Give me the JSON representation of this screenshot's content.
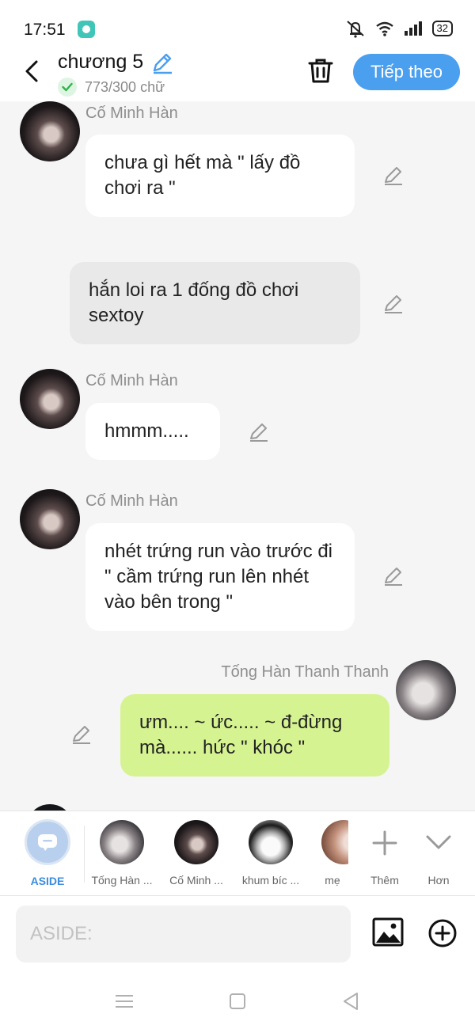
{
  "status_bar": {
    "time": "17:51",
    "battery": "32"
  },
  "header": {
    "title": "chương 5",
    "word_count": "773/300 chữ",
    "next_label": "Tiếp theo"
  },
  "messages": [
    {
      "side": "left",
      "sender": "Cố Minh Hàn",
      "text": "chưa gì hết mà \" lấy đồ chơi ra \"",
      "style": "white"
    },
    {
      "side": "narration",
      "text": "hắn loi ra 1 đống đồ chơi sextoy",
      "style": "gray"
    },
    {
      "side": "left",
      "sender": "Cố Minh Hàn",
      "text": "hmmm.....",
      "style": "white"
    },
    {
      "side": "left",
      "sender": "Cố Minh Hàn",
      "text": "nhét trứng run vào trước đi \" cầm trứng run lên nhét vào bên trong \"",
      "style": "white"
    },
    {
      "side": "right",
      "sender": "Tống Hàn Thanh Thanh",
      "text": "ưm.... ~ ức..... ~ đ-đừng mà...... hức \" khóc \"",
      "style": "green"
    }
  ],
  "characters": [
    {
      "label": "ASIDE",
      "icon": "aside-icon",
      "selected": true
    },
    {
      "label": "Tống Hàn ...",
      "avatar": "pale"
    },
    {
      "label": "Cố Minh ...",
      "avatar": "dark"
    },
    {
      "label": "khum bíc ...",
      "avatar": "manga"
    },
    {
      "label": "mẹ",
      "avatar": "warm"
    }
  ],
  "character_actions": {
    "add_label": "Thêm",
    "more_label": "Hơn"
  },
  "input": {
    "placeholder": "ASIDE:"
  },
  "colors": {
    "accent": "#4a9fef",
    "right_bubble": "#d6f391",
    "narration_bubble": "#e9e9e9",
    "background": "#f5f5f5"
  }
}
